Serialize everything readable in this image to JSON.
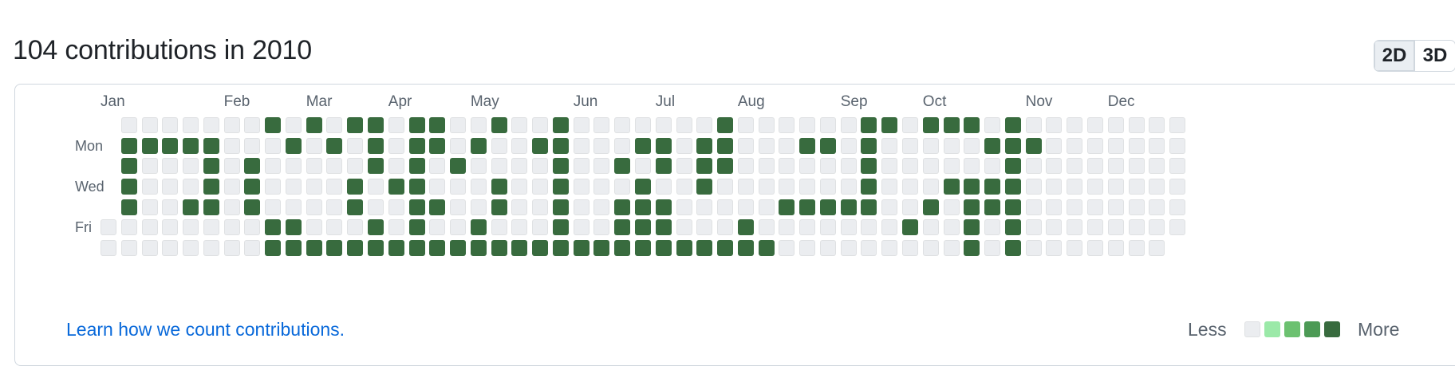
{
  "header": {
    "title": "104 contributions in 2010"
  },
  "view_toggle": {
    "options": [
      "2D",
      "3D"
    ],
    "active": "2D"
  },
  "calendar": {
    "months": [
      {
        "label": "Jan",
        "week": 0
      },
      {
        "label": "Feb",
        "week": 6
      },
      {
        "label": "Mar",
        "week": 10
      },
      {
        "label": "Apr",
        "week": 14
      },
      {
        "label": "May",
        "week": 18
      },
      {
        "label": "Jun",
        "week": 23
      },
      {
        "label": "Jul",
        "week": 27
      },
      {
        "label": "Aug",
        "week": 31
      },
      {
        "label": "Sep",
        "week": 36
      },
      {
        "label": "Oct",
        "week": 40
      },
      {
        "label": "Nov",
        "week": 45
      },
      {
        "label": "Dec",
        "week": 49
      }
    ],
    "weekdays": [
      {
        "label": "Mon",
        "row": 1
      },
      {
        "label": "Wed",
        "row": 3
      },
      {
        "label": "Fri",
        "row": 5
      }
    ],
    "first_week_start_row": 5,
    "last_week_end_row": 5,
    "weeks": 53,
    "contributions": [
      [
        1,
        0
      ],
      [
        2,
        0
      ],
      [
        3,
        0
      ],
      [
        4,
        0
      ],
      [
        1,
        1
      ],
      [
        1,
        2
      ],
      [
        1,
        3
      ],
      [
        4,
        3
      ],
      [
        1,
        4
      ],
      [
        2,
        4
      ],
      [
        3,
        4
      ],
      [
        4,
        4
      ],
      [
        2,
        6
      ],
      [
        3,
        6
      ],
      [
        4,
        6
      ],
      [
        0,
        7
      ],
      [
        5,
        7
      ],
      [
        6,
        7
      ],
      [
        1,
        8
      ],
      [
        5,
        8
      ],
      [
        6,
        8
      ],
      [
        0,
        9
      ],
      [
        6,
        9
      ],
      [
        1,
        10
      ],
      [
        6,
        10
      ],
      [
        0,
        11
      ],
      [
        3,
        11
      ],
      [
        4,
        11
      ],
      [
        6,
        11
      ],
      [
        0,
        12
      ],
      [
        1,
        12
      ],
      [
        2,
        12
      ],
      [
        5,
        12
      ],
      [
        6,
        12
      ],
      [
        3,
        13
      ],
      [
        6,
        13
      ],
      [
        0,
        14
      ],
      [
        1,
        14
      ],
      [
        2,
        14
      ],
      [
        3,
        14
      ],
      [
        4,
        14
      ],
      [
        5,
        14
      ],
      [
        6,
        14
      ],
      [
        0,
        15
      ],
      [
        1,
        15
      ],
      [
        4,
        15
      ],
      [
        6,
        15
      ],
      [
        2,
        16
      ],
      [
        6,
        16
      ],
      [
        1,
        17
      ],
      [
        5,
        17
      ],
      [
        6,
        17
      ],
      [
        0,
        18
      ],
      [
        3,
        18
      ],
      [
        4,
        18
      ],
      [
        6,
        18
      ],
      [
        6,
        19
      ],
      [
        1,
        20
      ],
      [
        6,
        20
      ],
      [
        0,
        21
      ],
      [
        1,
        21
      ],
      [
        2,
        21
      ],
      [
        3,
        21
      ],
      [
        4,
        21
      ],
      [
        5,
        21
      ],
      [
        6,
        21
      ],
      [
        6,
        22
      ],
      [
        6,
        23
      ],
      [
        2,
        24
      ],
      [
        4,
        24
      ],
      [
        5,
        24
      ],
      [
        6,
        24
      ],
      [
        1,
        25
      ],
      [
        3,
        25
      ],
      [
        4,
        25
      ],
      [
        5,
        25
      ],
      [
        6,
        25
      ],
      [
        1,
        26
      ],
      [
        2,
        26
      ],
      [
        4,
        26
      ],
      [
        5,
        26
      ],
      [
        6,
        26
      ],
      [
        6,
        27
      ],
      [
        1,
        28
      ],
      [
        2,
        28
      ],
      [
        3,
        28
      ],
      [
        6,
        28
      ],
      [
        0,
        29
      ],
      [
        1,
        29
      ],
      [
        2,
        29
      ],
      [
        6,
        29
      ],
      [
        5,
        30
      ],
      [
        6,
        30
      ],
      [
        6,
        31
      ],
      [
        4,
        32
      ],
      [
        1,
        33
      ],
      [
        4,
        33
      ],
      [
        1,
        34
      ],
      [
        4,
        34
      ],
      [
        4,
        35
      ],
      [
        0,
        36
      ],
      [
        1,
        36
      ],
      [
        2,
        36
      ],
      [
        3,
        36
      ],
      [
        4,
        36
      ],
      [
        0,
        37
      ],
      [
        5,
        38
      ],
      [
        0,
        39
      ],
      [
        4,
        39
      ],
      [
        0,
        40
      ],
      [
        3,
        40
      ],
      [
        0,
        41
      ],
      [
        3,
        41
      ],
      [
        4,
        41
      ],
      [
        5,
        41
      ],
      [
        6,
        41
      ],
      [
        1,
        42
      ],
      [
        3,
        42
      ],
      [
        4,
        42
      ],
      [
        0,
        43
      ],
      [
        1,
        43
      ],
      [
        2,
        43
      ],
      [
        3,
        43
      ],
      [
        4,
        43
      ],
      [
        5,
        43
      ],
      [
        6,
        43
      ],
      [
        1,
        44
      ]
    ],
    "level": "l4"
  },
  "footer": {
    "learn_link": "Learn how we count contributions.",
    "legend_less": "Less",
    "legend_more": "More",
    "legend_levels": [
      "l0",
      "l1",
      "l2",
      "l3",
      "l4"
    ]
  }
}
